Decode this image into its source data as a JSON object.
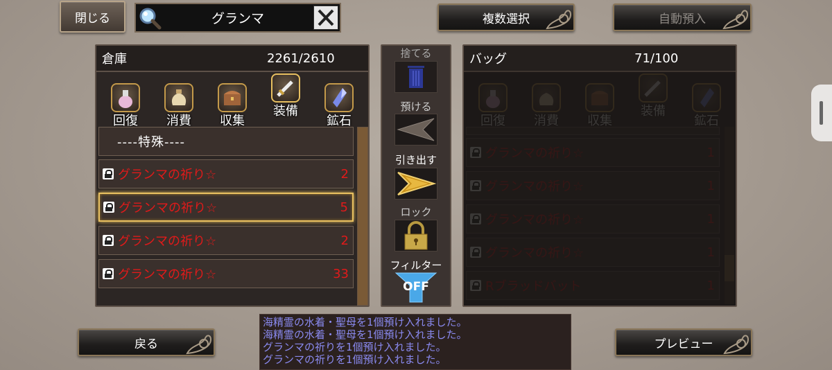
{
  "top": {
    "close_label": "閉じる",
    "search_value": "グランマ",
    "multi_select_label": "複数選択",
    "auto_deposit_label": "自動預入"
  },
  "storage": {
    "title": "倉庫",
    "count": "2261/2610",
    "categories": [
      {
        "label": "回復",
        "icon": "potion-icon"
      },
      {
        "label": "消費",
        "icon": "pouch-icon"
      },
      {
        "label": "収集",
        "icon": "chest-icon"
      },
      {
        "label": "装備",
        "icon": "sword-icon"
      },
      {
        "label": "鉱石",
        "icon": "crystal-icon"
      }
    ],
    "section_label": "----特殊----",
    "items": [
      {
        "name": "グランマの祈り☆",
        "qty": "2"
      },
      {
        "name": "グランマの祈り☆",
        "qty": "5"
      },
      {
        "name": "グランマの祈り☆",
        "qty": "2"
      },
      {
        "name": "グランマの祈り☆",
        "qty": "33"
      }
    ]
  },
  "middle": {
    "discard_label": "捨てる",
    "deposit_label": "預ける",
    "withdraw_label": "引き出す",
    "lock_label": "ロック",
    "filter_label": "フィルター",
    "filter_state": "OFF"
  },
  "bag": {
    "title": "バッグ",
    "count": "71/100",
    "categories": [
      {
        "label": "回復",
        "icon": "potion-icon"
      },
      {
        "label": "消費",
        "icon": "pouch-icon"
      },
      {
        "label": "収集",
        "icon": "chest-icon"
      },
      {
        "label": "装備",
        "icon": "sword-icon"
      },
      {
        "label": "鉱石",
        "icon": "crystal-icon"
      }
    ],
    "items": [
      {
        "name": "グランマの祈り☆",
        "qty": "1"
      },
      {
        "name": "グランマの祈り☆",
        "qty": "1"
      },
      {
        "name": "グランマの祈り☆",
        "qty": "1"
      },
      {
        "name": "グランマの祈り☆",
        "qty": "1"
      },
      {
        "name": "Rブラッドバット",
        "qty": "1"
      }
    ]
  },
  "bottom": {
    "back_label": "戻る",
    "preview_label": "プレビュー"
  },
  "log": [
    "海精霊の水着・聖母を1個預け入れました。",
    "海精霊の水着・聖母を1個預け入れました。",
    "グランマの祈りを1個預け入れました。",
    "グランマの祈りを1個預け入れました。"
  ],
  "colors": {
    "item_red": "#e01a1a",
    "log_text": "#8a8af0",
    "accent_gold": "#d4a640",
    "filter_blue": "#4aa8e8"
  }
}
